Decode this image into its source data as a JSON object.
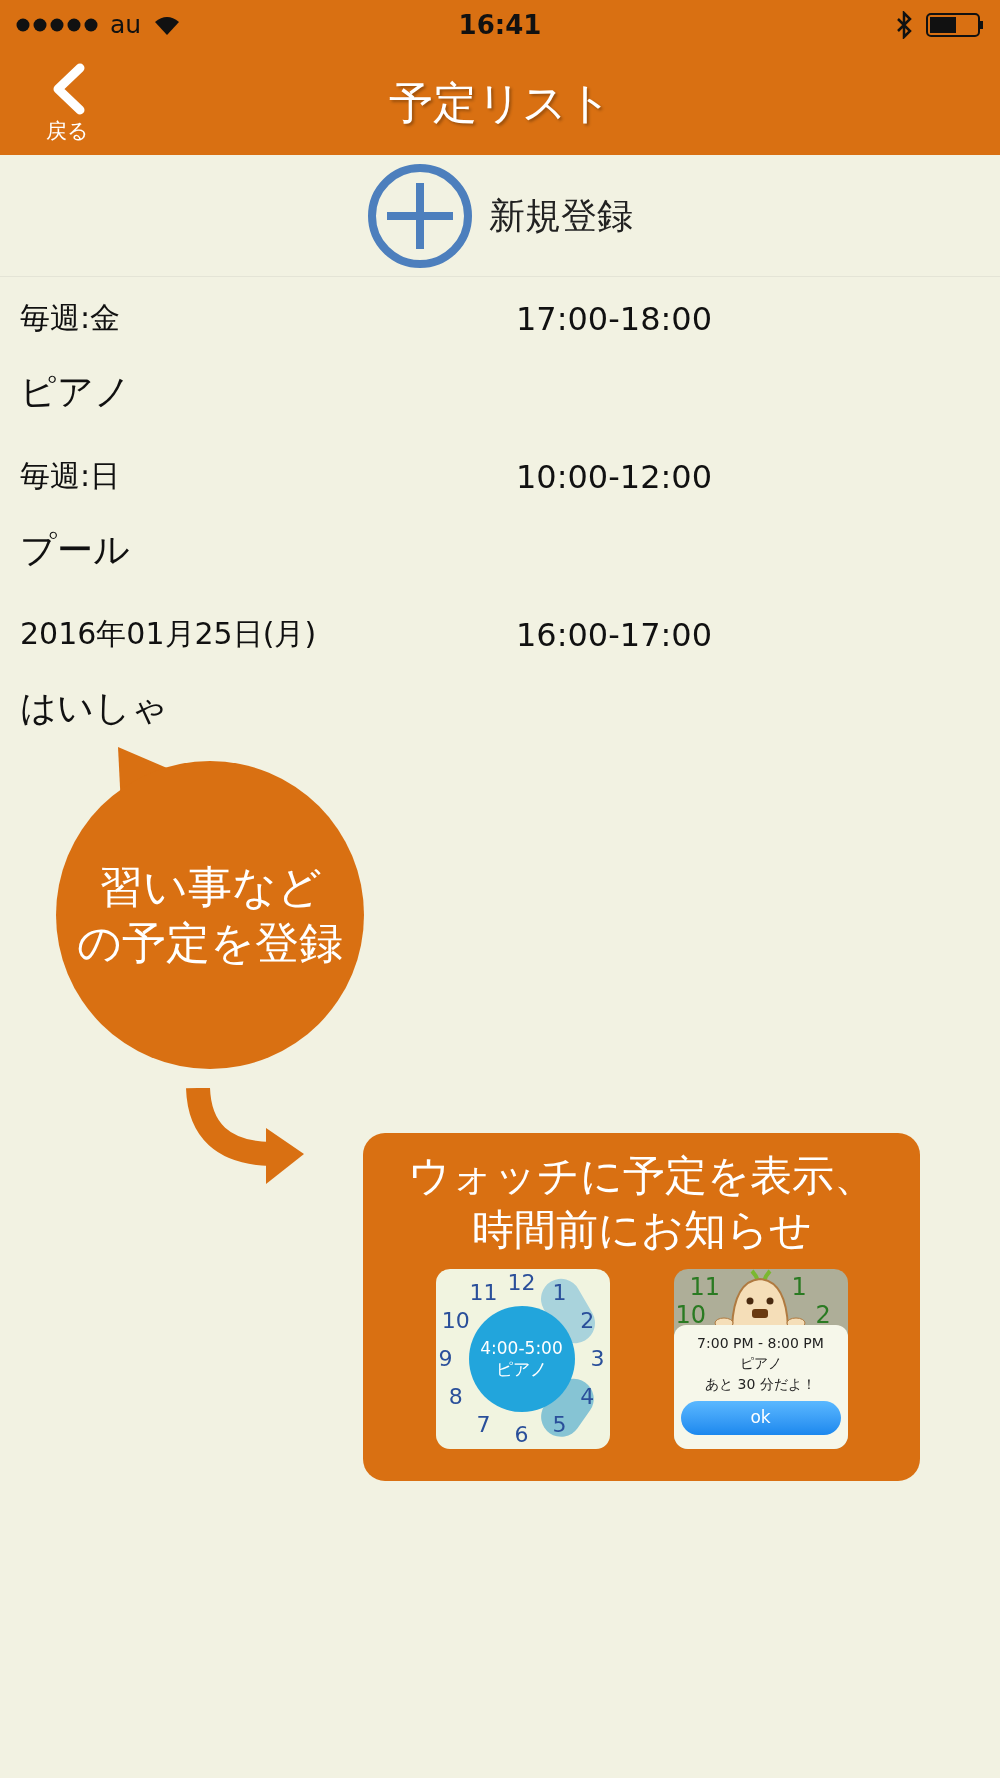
{
  "status_bar": {
    "carrier": "au",
    "time": "16:41"
  },
  "nav": {
    "back": "戻る",
    "title": "予定リスト"
  },
  "add_button": {
    "label": "新規登録"
  },
  "schedules": [
    {
      "when": "毎週:金",
      "time": "17:00-18:00",
      "name": "ピアノ"
    },
    {
      "when": "毎週:日",
      "time": "10:00-12:00",
      "name": "プール"
    },
    {
      "when": "2016年01月25日(月)",
      "time": "16:00-17:00",
      "name": "はいしゃ"
    }
  ],
  "callout": {
    "lines": [
      "習い事など",
      "の予定を登録"
    ]
  },
  "watch_panel": {
    "title_lines": [
      "ウォッチに予定を表示、",
      "時間前にお知らせ"
    ],
    "screens": [
      {
        "kind": "clock",
        "numbers": [
          "12",
          "11",
          "1",
          "10",
          "2",
          "9",
          "3",
          "8",
          "4",
          "7",
          "5",
          "6"
        ],
        "event_time": "4:00-5:00",
        "event_name": "ピアノ"
      },
      {
        "kind": "alert",
        "numbers": [
          "11",
          "1",
          "10",
          "2"
        ],
        "time": "7:00 PM - 8:00 PM",
        "name": "ピアノ",
        "message": "あと 30 分だよ！",
        "button": "ok"
      }
    ]
  }
}
